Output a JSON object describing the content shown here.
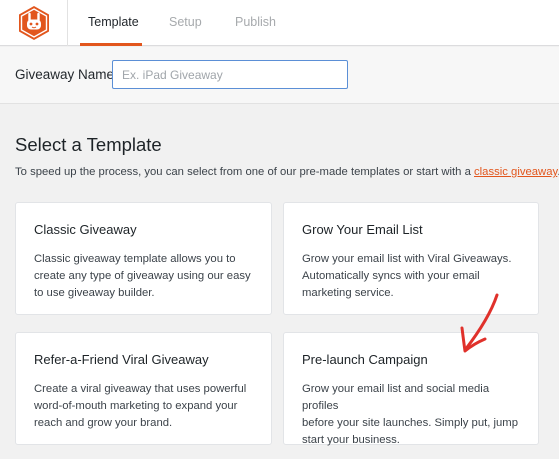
{
  "header": {
    "logo_icon": "rabbit-logo-icon",
    "brand_color": "#e2561d",
    "tabs": [
      {
        "label": "Template",
        "active": true
      },
      {
        "label": "Setup",
        "active": false
      },
      {
        "label": "Publish",
        "active": false
      }
    ]
  },
  "giveaway_name": {
    "label": "Giveaway Name",
    "value": "",
    "placeholder": "Ex. iPad Giveaway"
  },
  "templates_section": {
    "title": "Select a Template",
    "description_prefix": "To speed up the process, you can select from one of our pre-made templates or start with a",
    "description_link": "classic giveaway",
    "description_suffix": "."
  },
  "templates": [
    {
      "title": "Classic Giveaway",
      "lines": [
        "Classic giveaway template allows you to",
        "create any type of giveaway using our easy",
        "to use giveaway builder."
      ]
    },
    {
      "title": "Grow Your Email List",
      "lines": [
        "Grow your email list with Viral Giveaways.",
        "Automatically syncs with your email",
        "marketing service."
      ]
    },
    {
      "title": "Refer-a-Friend Viral Giveaway",
      "lines": [
        "Create a viral giveaway that uses powerful",
        "word-of-mouth marketing to expand your",
        "reach and grow your brand."
      ]
    },
    {
      "title": "Pre-launch Campaign",
      "lines": [
        "Grow your email list and social media profiles",
        "before your site launches. Simply put, jump",
        "start your business."
      ]
    }
  ],
  "annotation": {
    "icon": "red-arrow-annotation-icon",
    "color": "#e0312b"
  }
}
